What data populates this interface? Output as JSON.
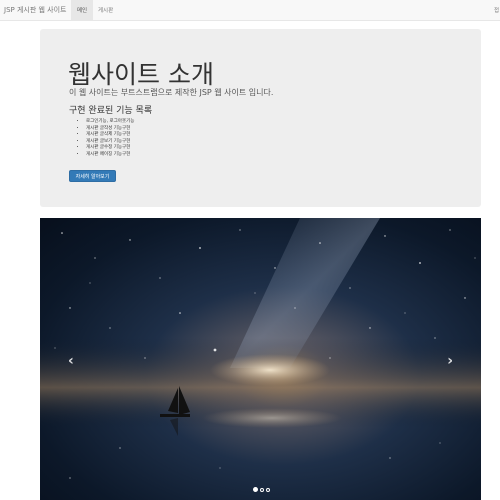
{
  "navbar": {
    "brand": "JSP 게시판 웹 사이트",
    "items": [
      {
        "label": "메인",
        "active": true
      },
      {
        "label": "게시판",
        "active": false
      }
    ],
    "right_label": "접"
  },
  "jumbotron": {
    "title": "웹사이트 소개",
    "lead": "이 웹 사이트는 부트스트랩으로 제작한 JSP 웹 사이트 입니다.",
    "subtitle": "구현 완료된 기능 목록",
    "features": [
      "로그인기능, 로그아웃기능",
      "게시판 글작성 기능구현",
      "게시판 글삭제 기능구현",
      "게시판 글보기 기능구현",
      "게시판 글수정 기능구현",
      "게시판 페이징 기능구현"
    ],
    "button_label": "자세히 알아보기",
    "button_color": "#337ab7"
  },
  "carousel": {
    "image": "night-sky-sailboat",
    "prev_icon": "chevron-left-icon",
    "next_icon": "chevron-right-icon",
    "slide_count": 3,
    "active_slide": 1
  }
}
